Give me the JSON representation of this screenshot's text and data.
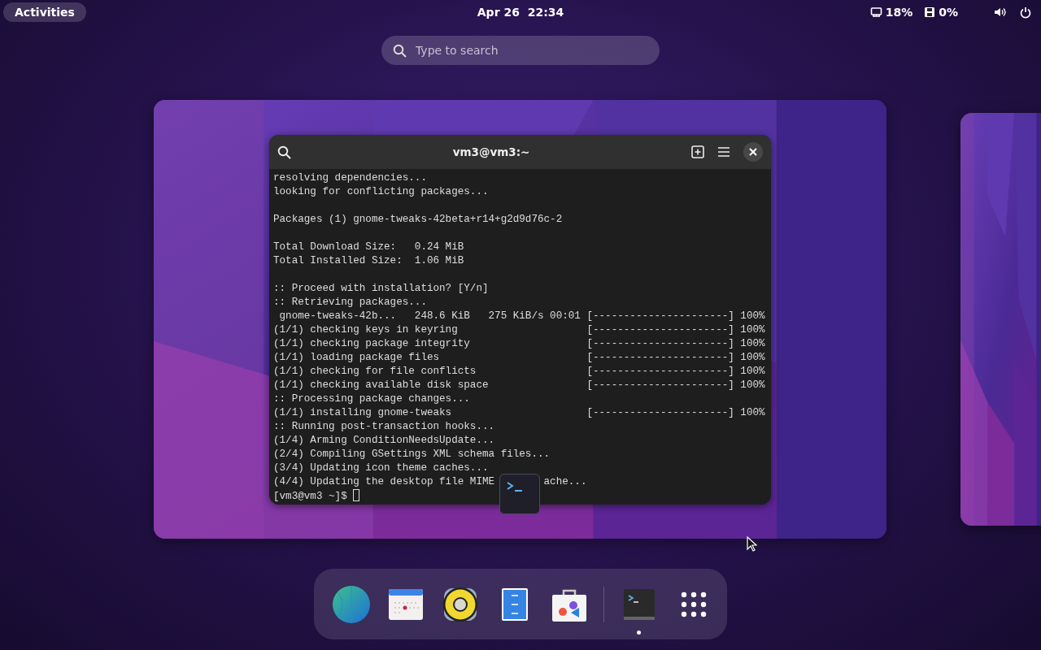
{
  "top_bar": {
    "activities": "Activities",
    "clock": "Apr 26  22:34",
    "cpu": "18%",
    "memory": "0%"
  },
  "search": {
    "placeholder": "Type to search"
  },
  "terminal": {
    "title": "vm3@vm3:~",
    "blocks": [
      [
        "resolving dependencies...",
        "looking for conflicting packages..."
      ],
      [
        "Packages (1) gnome-tweaks-42beta+r14+g2d9d76c-2"
      ],
      [
        "Total Download Size:   0.24 MiB",
        "Total Installed Size:  1.06 MiB"
      ],
      [
        ":: Proceed with installation? [Y/n]",
        ":: Retrieving packages...",
        " gnome-tweaks-42b...   248.6 KiB   275 KiB/s 00:01 [----------------------] 100%",
        "(1/1) checking keys in keyring                     [----------------------] 100%",
        "(1/1) checking package integrity                   [----------------------] 100%",
        "(1/1) loading package files                        [----------------------] 100%",
        "(1/1) checking for file conflicts                  [----------------------] 100%",
        "(1/1) checking available disk space                [----------------------] 100%",
        ":: Processing package changes...",
        "(1/1) installing gnome-tweaks                      [----------------------] 100%",
        ":: Running post-transaction hooks...",
        "(1/4) Arming ConditionNeedsUpdate...",
        "(2/4) Compiling GSettings XML schema files...",
        "(3/4) Updating icon theme caches...",
        [
          "(4/4) Updating the desktop file MIME",
          "ache..."
        ]
      ]
    ],
    "prompt": "[vm3@vm3 ~]$"
  },
  "dock": {
    "apps": [
      {
        "kind": "globe",
        "running": false
      },
      {
        "kind": "calendar",
        "running": false
      },
      {
        "kind": "speaker",
        "running": false
      },
      {
        "kind": "cabinet",
        "running": false
      },
      {
        "kind": "bag",
        "running": false
      },
      {
        "kind": "terminal",
        "running": true
      },
      {
        "kind": "grid",
        "running": false
      }
    ]
  }
}
